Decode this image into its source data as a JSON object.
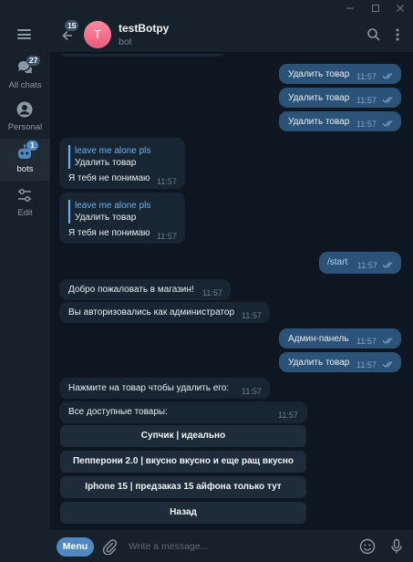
{
  "sidebar": {
    "folders": [
      {
        "label": "All chats",
        "badge": "27"
      },
      {
        "label": "Personal",
        "badge": ""
      },
      {
        "label": "bots",
        "badge": "1"
      },
      {
        "label": "Edit",
        "badge": ""
      }
    ]
  },
  "header": {
    "unread_count": "15",
    "avatar_letter": "T",
    "name": "testBotpy",
    "status": "bot"
  },
  "messages": [
    {
      "dir": "out",
      "text": "Удалить товар",
      "time": "11:57"
    },
    {
      "dir": "out",
      "text": "Удалить товар",
      "time": "11:57"
    },
    {
      "dir": "out",
      "text": "Удалить товар",
      "time": "11:57"
    },
    {
      "dir": "in",
      "reply_name": "leave me alone pls",
      "reply_text": "Удалить товар",
      "text": "Я тебя не понимаю",
      "time": "11:57"
    },
    {
      "dir": "in",
      "reply_name": "leave me alone pls",
      "reply_text": "Удалить товар",
      "text": "Я тебя не понимаю",
      "time": "11:57"
    },
    {
      "dir": "out",
      "text": "/start",
      "time": "11:57"
    },
    {
      "dir": "in",
      "text": "Добро пожаловать в магазин!",
      "time": "11:57"
    },
    {
      "dir": "in",
      "text": "Вы авторизовались как администратор",
      "time": "11:57"
    },
    {
      "dir": "out",
      "text": "Админ-панель",
      "time": "11:57"
    },
    {
      "dir": "out",
      "text": "Удалить товар",
      "time": "11:57"
    },
    {
      "dir": "in",
      "text": "Нажмите на товар чтобы удалить его:",
      "time": "11:57"
    },
    {
      "dir": "in",
      "text": "Все доступные товары:",
      "time": "11:57"
    }
  ],
  "inline_keyboard": [
    "Супчик | идеально",
    "Пепперони 2.0 | вкусно вкусно и еще ращ вкусно",
    "Iphone 15 | предзаказ 15 айфона только тут",
    "Назад"
  ],
  "composer": {
    "menu_label": "Menu",
    "placeholder": "Write a message..."
  },
  "colors": {
    "background": "#0e1621",
    "panel": "#17212b",
    "outgoing_bubble": "#2b5278",
    "incoming_bubble": "#182533",
    "accent": "#5288c1",
    "link": "#6ab2f2"
  }
}
